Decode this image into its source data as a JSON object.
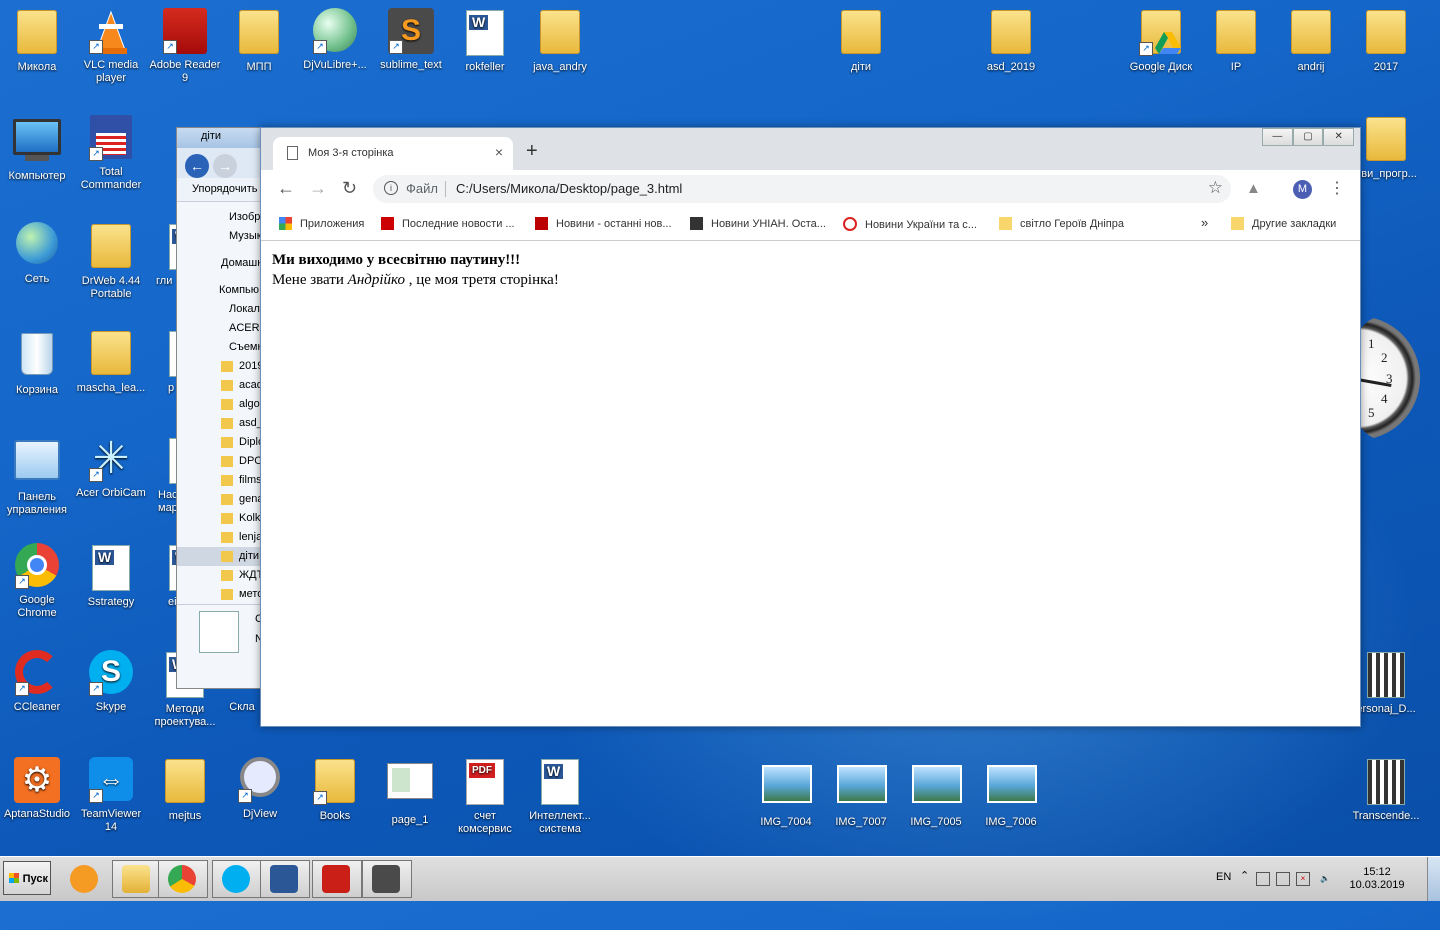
{
  "desktop_icons": {
    "mykola": "Микола",
    "vlc": "VLC media player",
    "adobe_reader": "Adobe Reader 9",
    "mpp": "МПП",
    "djvulibre": "DjVuLibre+...",
    "sublime": "sublime_text",
    "rokfeller": "rokfeller",
    "java_andry": "java_andry",
    "dity": "діти",
    "asd_2019": "asd_2019",
    "google_disk": "Google Диск",
    "ip": "IP",
    "andrij": "andrij",
    "y2017": "2017",
    "computer": "Компьютер",
    "total_commander": "Total Commander",
    "program": "ови_прогр...",
    "network": "Сеть",
    "drweb": "DrWeb 4.44 Portable",
    "gli": "гли",
    "trash": "Корзина",
    "mascha": "mascha_lea...",
    "p": "p",
    "control_panel": "Панель управления",
    "acer_orbicam": "Acer OrbiCam",
    "nas_mar": "Нас марш",
    "chrome": "Google Chrome",
    "sstrategy": "Sstrategy",
    "ei": "ei",
    "ccleaner": "CCleaner",
    "skype": "Skype",
    "methods": "Методи проектува...",
    "skla": "Скла",
    "personaj": "ersonaj_D...",
    "aptana": "AptanaStudio",
    "teamviewer": "TeamViewer 14",
    "mejtus": "mejtus",
    "djview": "DjView",
    "books": "Books",
    "page_1": "page_1",
    "schet": "счет комсервис",
    "intellect": "Интеллект... система",
    "img_7004": "IMG_7004",
    "img_7007": "IMG_7007",
    "img_7005": "IMG_7005",
    "img_7006": "IMG_7006",
    "transcend": "Transcende..."
  },
  "explorer": {
    "title": "діти",
    "organize": "Упорядочить",
    "nav_items": [
      "Изобр",
      "Музык",
      "Домашн",
      "Компью",
      "Локал",
      "ACERD",
      "Съемн",
      "2019",
      "acad",
      "algo",
      "asd_",
      "Diplo",
      "DPO",
      "films",
      "gena",
      "Kolko",
      "lenja",
      "діти",
      "ЖДТ",
      "мето"
    ],
    "detail_letter": "C",
    "detail_letter2": "N"
  },
  "chrome": {
    "tab_title": "Моя 3-я сторінка",
    "new_tab": "+",
    "tab_close": "×",
    "address_prefix": "Файл",
    "url": "C:/Users/Микола/Desktop/page_3.html",
    "profile_letter": "M",
    "bookmarks": [
      "Приложения",
      "Последние новости ...",
      "Новини - останні нов...",
      "Новини УНІАН. Оста...",
      "Новини України та с...",
      "світло Героїв Дніпра"
    ],
    "more_bookmarks": "»",
    "other_bookmarks": "Другие закладки",
    "window_buttons": [
      "—",
      "▢",
      "✕"
    ]
  },
  "page": {
    "heading": "Ми виходимо у всесвітню паутину!!!",
    "text_before": "Мене звати ",
    "name": "Андрійко",
    "text_after": " , це моя третя сторінка!"
  },
  "taskbar": {
    "start": "Пуск",
    "language": "EN",
    "time": "15:12",
    "date": "10.03.2019"
  },
  "clock": {
    "numbers": [
      "1",
      "2",
      "3",
      "4",
      "5"
    ]
  }
}
